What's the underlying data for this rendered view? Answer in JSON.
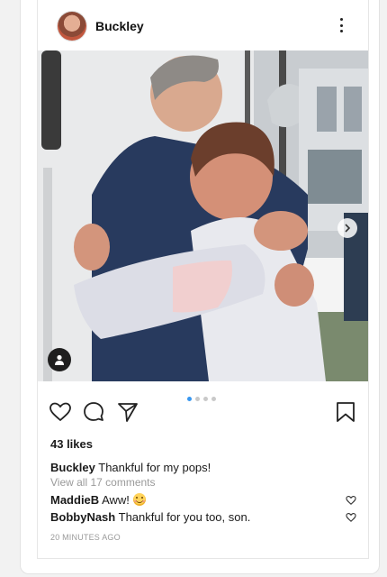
{
  "post": {
    "username": "Buckley",
    "likes": "43 likes",
    "caption_user": "Buckley",
    "caption_text": "Thankful for my pops!",
    "view_comments": "View all 17 comments",
    "comments": [
      {
        "user": "MaddieB",
        "text": "Aww! ",
        "emoji": "smiling-face-icon"
      },
      {
        "user": "BobbyNash",
        "text": "Thankful for you too, son."
      }
    ],
    "timestamp": "20 MINUTES AGO",
    "carousel": {
      "total": 4,
      "active_index": 0
    }
  },
  "icons": {
    "more": "more-options-icon",
    "like": "heart-icon",
    "comment": "comment-bubble-icon",
    "share": "send-icon",
    "save": "bookmark-icon",
    "tag": "user-tag-icon",
    "next": "chevron-right-icon"
  },
  "colors": {
    "carousel_active": "#3897f0",
    "carousel_inactive": "#c9c9c9"
  }
}
